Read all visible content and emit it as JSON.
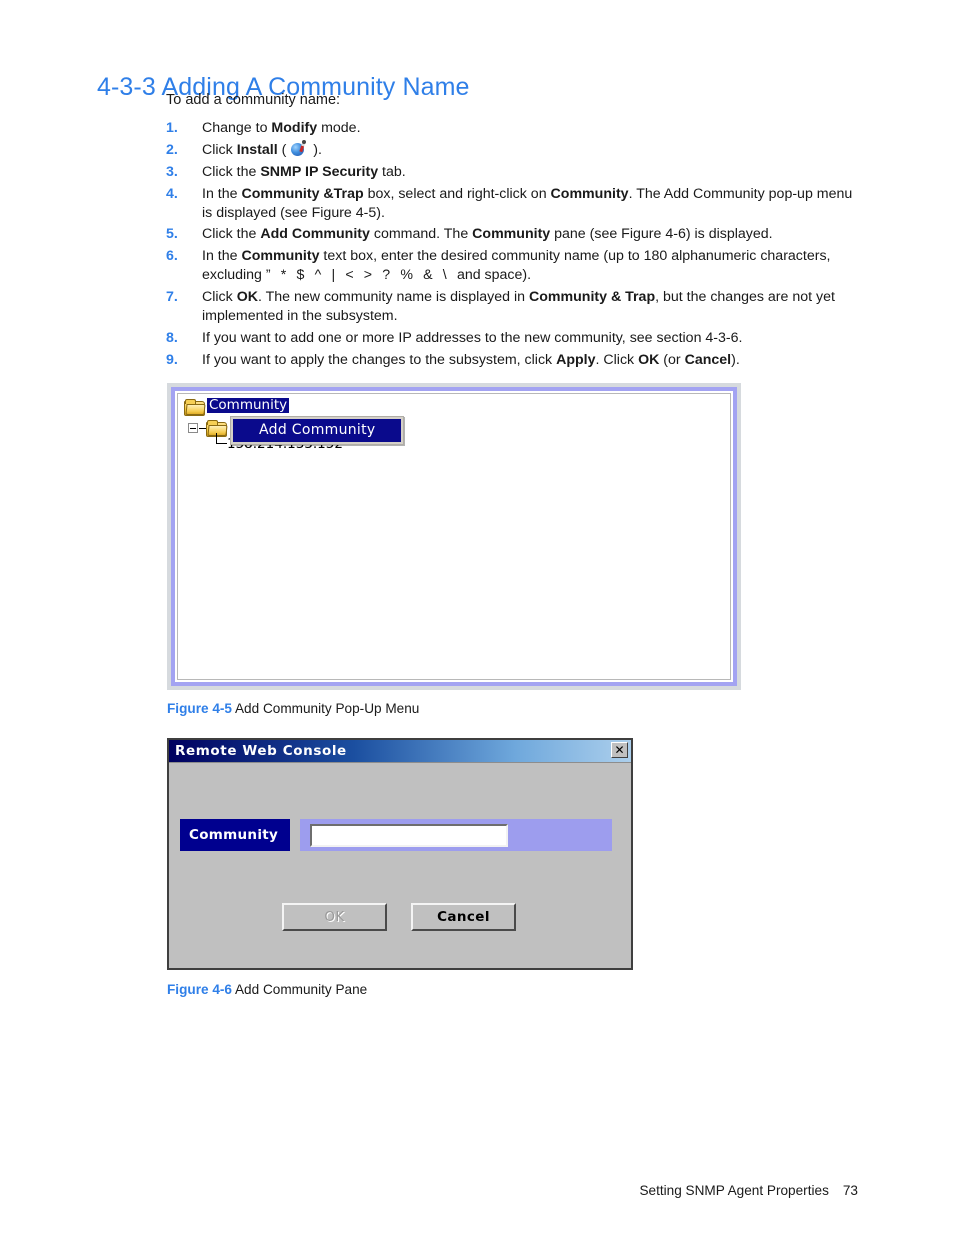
{
  "heading": "4-3-3 Adding A Community Name",
  "intro": "To add a community name:",
  "steps": [
    {
      "num": "1.",
      "html": "Change to <b>Modify</b> mode."
    },
    {
      "num": "2.",
      "html": "Click <b>Install</b> ( <span class=\"install-icon\" data-name=\"install-icon\" data-interactable=\"false\"><span class=\"ball\"></span><span class=\"stick\"></span><span class=\"tip\"></span></span> )."
    },
    {
      "num": "3.",
      "html": "Click the <b>SNMP IP Security</b> tab."
    },
    {
      "num": "4.",
      "html": "In the <b>Community &amp;Trap</b> box, select and right-click on <b>Community</b>. The Add Community pop-up menu is displayed (see Figure 4-5)."
    },
    {
      "num": "5.",
      "html": "Click the <b>Add Community</b> command. The <b>Community</b> pane (see Figure 4-6) is displayed."
    },
    {
      "num": "6.",
      "html": "In the <b>Community</b> text box, enter the desired community name (up to 180 alphanumeric characters, excluding <span class=\"spaced\">&rdquo; * $ ^ | &lt; &gt; ? % &amp; \\ </span> and space)."
    },
    {
      "num": "7.",
      "html": "Click <b>OK</b>. The new community name is displayed in <b>Community &amp; Trap</b>, but the changes are not yet implemented in the subsystem."
    },
    {
      "num": "8.",
      "html": "If you want to add one or more IP addresses to the new community, see section 4-3-6."
    },
    {
      "num": "9.",
      "html": "If you want to apply the changes to the subsystem, click <b>Apply</b>. Click <b>OK</b> (or <b>Cancel</b>)."
    }
  ],
  "figure1": {
    "tree": {
      "root_label": "Community",
      "child_label": "158.214.133.152"
    },
    "popup": {
      "item_label": "Add Community"
    },
    "caption_label": "Figure 4-5",
    "caption_text": " Add Community Pop-Up Menu"
  },
  "figure2": {
    "dialog": {
      "title": "Remote Web Console",
      "close_label": "✕",
      "field_label": "Community",
      "field_value": "",
      "field_placeholder": "",
      "ok_label": "OK",
      "cancel_label": "Cancel"
    },
    "caption_label": "Figure 4-6",
    "caption_text": " Add Community Pane"
  },
  "footer": {
    "text": "Setting SNMP Agent Properties",
    "page_number": "73"
  },
  "colors": {
    "accent_blue": "#2f7fe8",
    "tree_selection": "#0a0a8c",
    "dialog_face": "#c0c0c0",
    "field_label_bg": "#00008f",
    "field_area_bg": "#9d9dee",
    "figure_border": "#a3a3f2"
  }
}
